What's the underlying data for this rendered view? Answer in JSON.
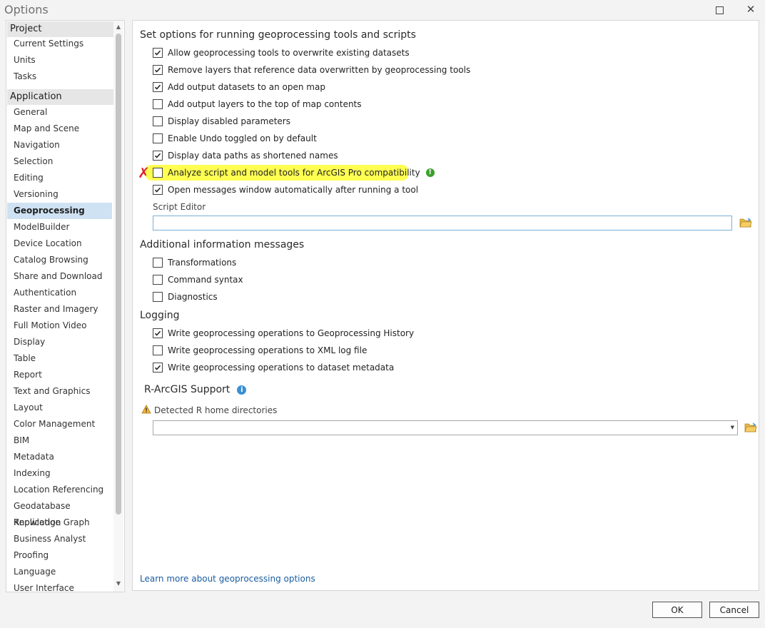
{
  "window": {
    "title": "Options"
  },
  "sidebar": {
    "groups": [
      {
        "label": "Project",
        "items": [
          "Current Settings",
          "Units",
          "Tasks"
        ]
      },
      {
        "label": "Application",
        "items": [
          "General",
          "Map and Scene",
          "Navigation",
          "Selection",
          "Editing",
          "Versioning",
          "Geoprocessing",
          "ModelBuilder",
          "Device Location",
          "Catalog Browsing",
          "Share and Download",
          "Authentication",
          "Raster and Imagery",
          "Full Motion Video",
          "Display",
          "Table",
          "Report",
          "Text and Graphics",
          "Layout",
          "Color Management",
          "BIM",
          "Metadata",
          "Indexing",
          "Location Referencing",
          "Geodatabase Replication",
          "Knowledge Graph",
          "Business Analyst",
          "Proofing",
          "Language",
          "User Interface"
        ]
      }
    ],
    "selected": "Geoprocessing"
  },
  "main": {
    "section1": {
      "heading": "Set options for running geoprocessing tools and scripts",
      "options": [
        {
          "label": "Allow geoprocessing tools to overwrite existing datasets",
          "checked": true
        },
        {
          "label": "Remove layers that reference data overwritten by geoprocessing tools",
          "checked": true
        },
        {
          "label": "Add output datasets to an open map",
          "checked": true
        },
        {
          "label": "Add output layers to the top of map contents",
          "checked": false
        },
        {
          "label": "Display disabled parameters",
          "checked": false
        },
        {
          "label": "Enable Undo toggled on by default",
          "checked": false
        },
        {
          "label": "Display data paths as shortened names",
          "checked": true
        },
        {
          "label": "Analyze script and model tools for ArcGIS Pro compatibility",
          "checked": false
        },
        {
          "label": "Open messages window automatically after running a tool",
          "checked": true
        }
      ],
      "script_editor_label": "Script Editor",
      "script_editor_value": ""
    },
    "section2": {
      "heading": "Additional information messages",
      "options": [
        {
          "label": "Transformations",
          "checked": false
        },
        {
          "label": "Command syntax",
          "checked": false
        },
        {
          "label": "Diagnostics",
          "checked": false
        }
      ]
    },
    "section3": {
      "heading": "Logging",
      "options": [
        {
          "label": "Write geoprocessing operations to Geoprocessing History",
          "checked": true
        },
        {
          "label": "Write geoprocessing operations to XML log file",
          "checked": false
        },
        {
          "label": "Write geoprocessing operations to dataset metadata",
          "checked": true
        }
      ]
    },
    "section4": {
      "heading": "R-ArcGIS Support",
      "detected_label": "Detected R home directories",
      "detected_value": ""
    },
    "learn_more_link": "Learn more about geoprocessing options"
  },
  "footer": {
    "ok_label": "OK",
    "cancel_label": "Cancel"
  },
  "colors": {
    "highlight": "#ffff52",
    "selected_item": "#cfe2f3",
    "link": "#1a5c9e",
    "annotation_mark": "#e02020"
  }
}
